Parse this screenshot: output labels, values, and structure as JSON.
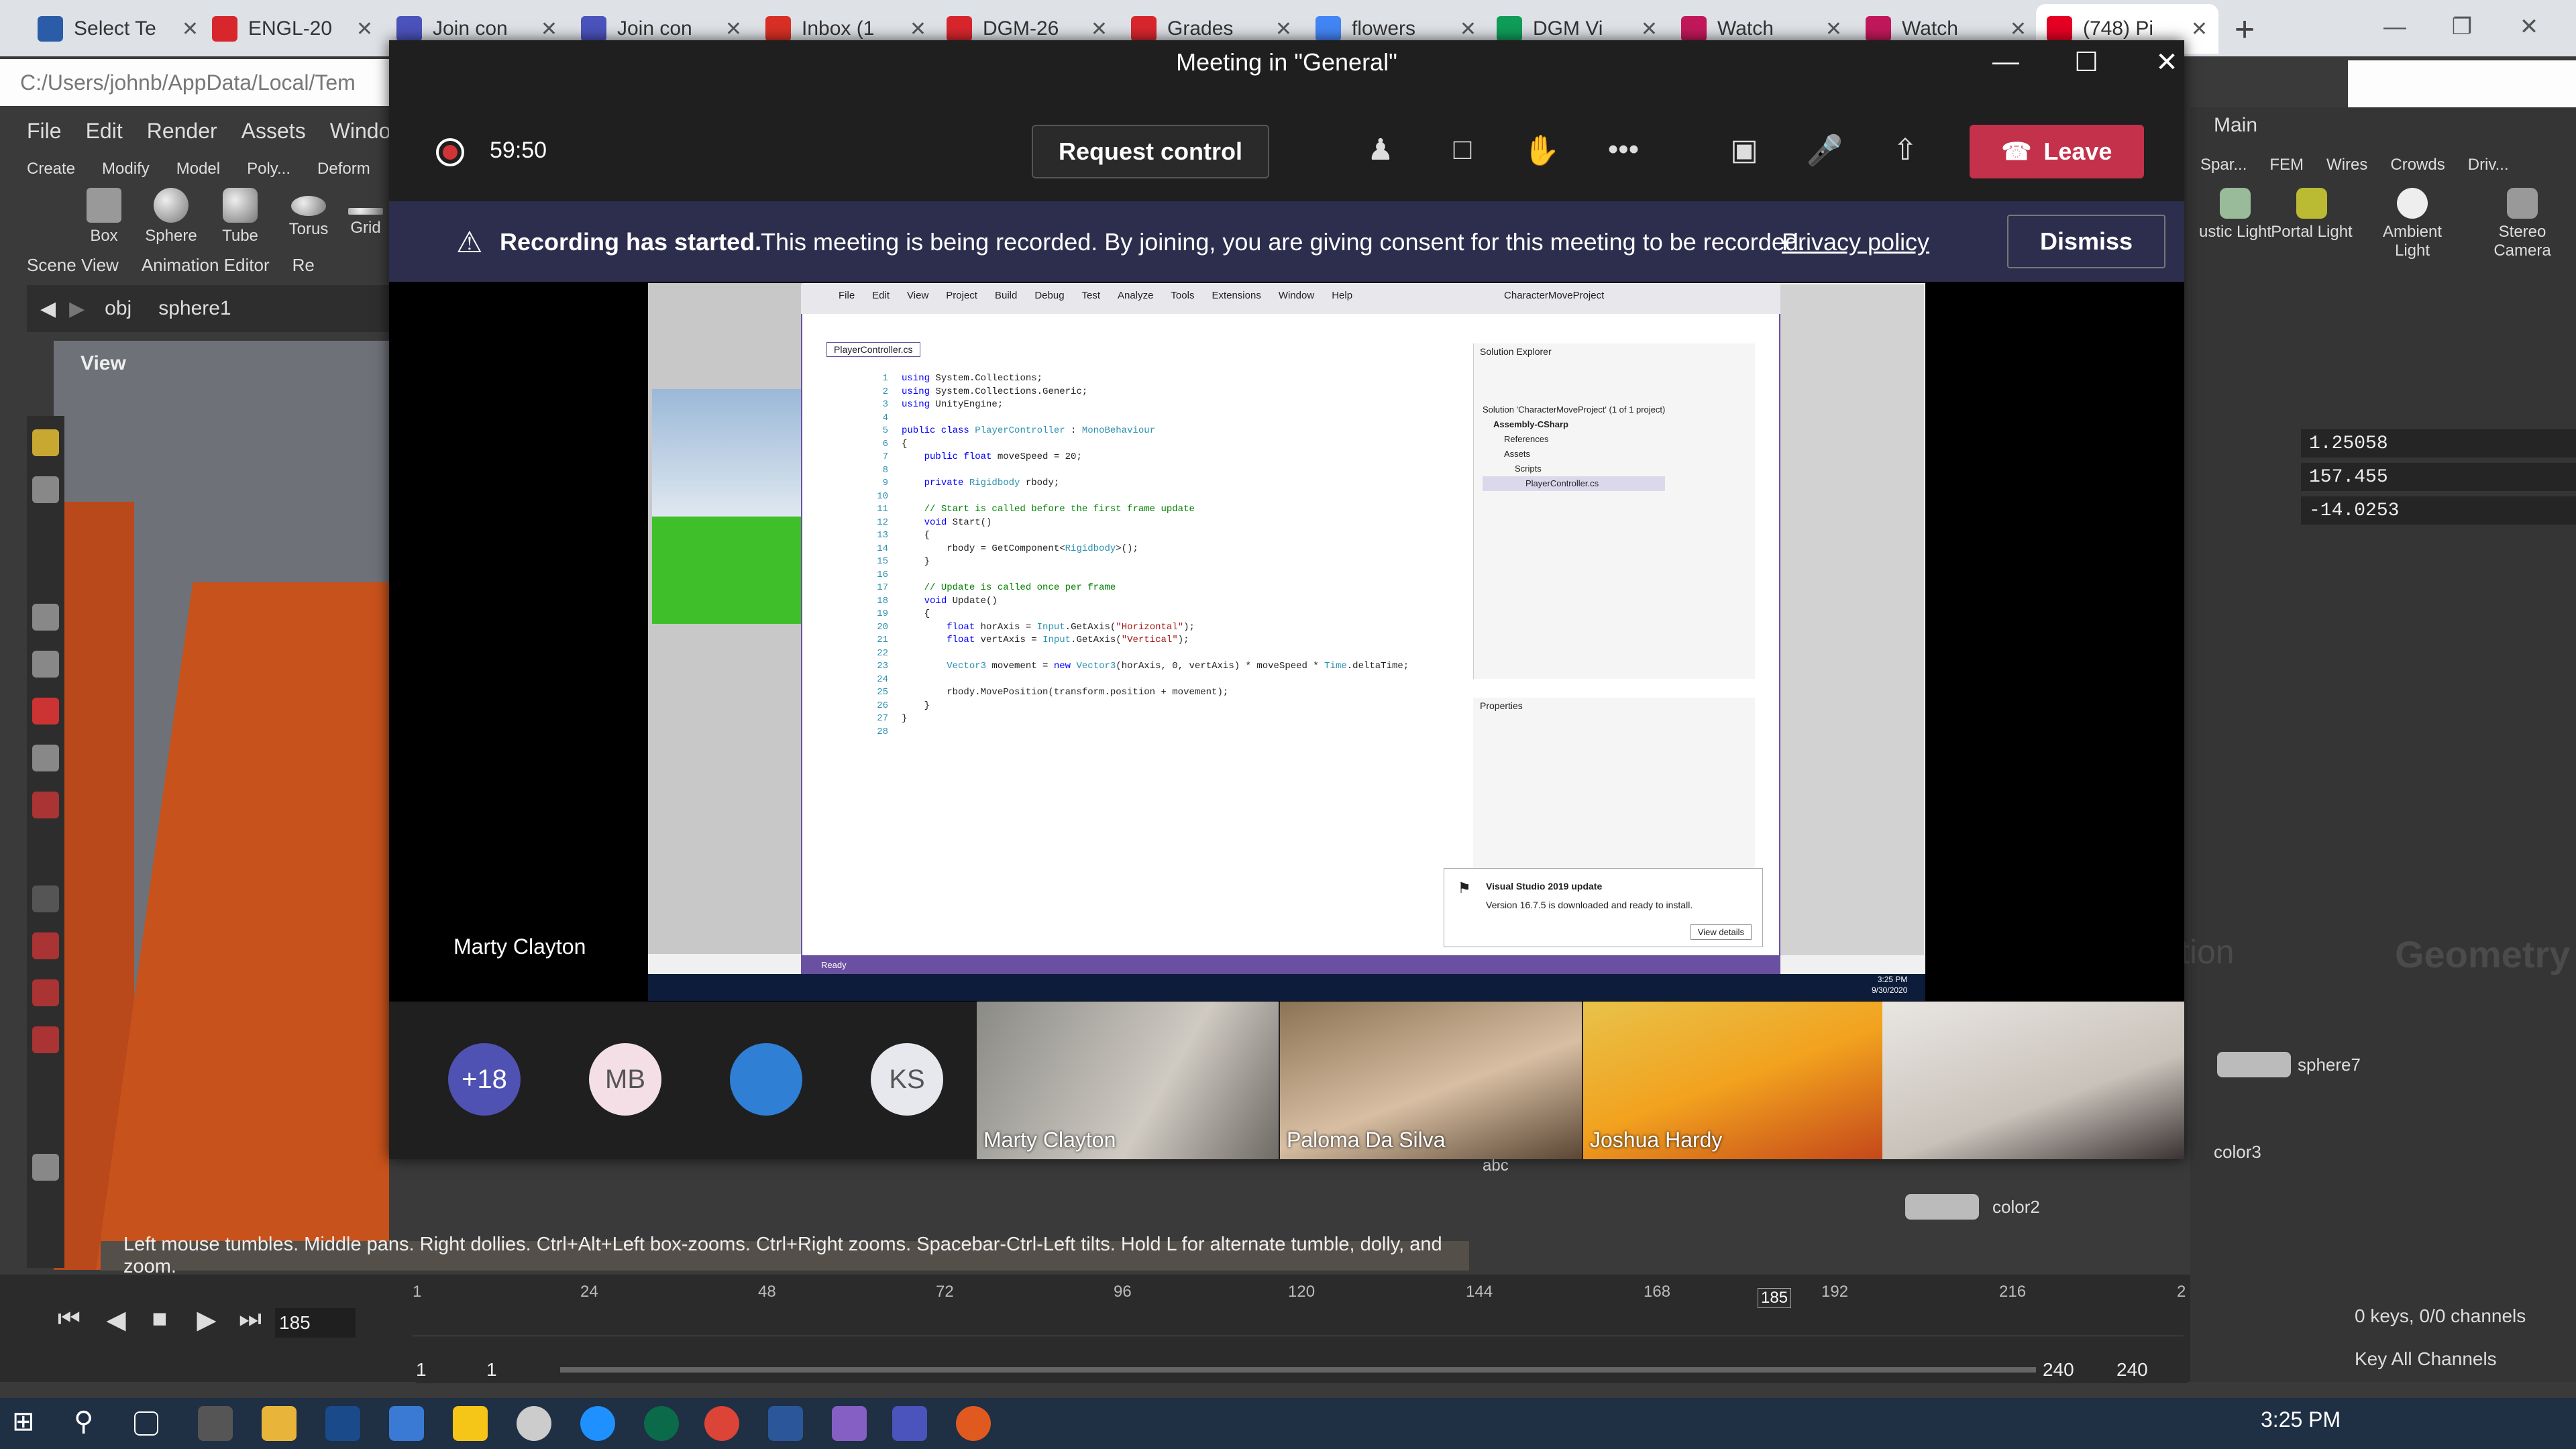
{
  "browser": {
    "tabs": [
      {
        "label": "Select Te",
        "color": "#2a5ca8"
      },
      {
        "label": "ENGL-20",
        "color": "#d8262d"
      },
      {
        "label": "Join con",
        "color": "#4b53bc"
      },
      {
        "label": "Join con",
        "color": "#4b53bc"
      },
      {
        "label": "Inbox (1",
        "color": "#d93025"
      },
      {
        "label": "DGM-26",
        "color": "#d8262d"
      },
      {
        "label": "Grades",
        "color": "#d8262d"
      },
      {
        "label": "flowers",
        "color": "#4285f4"
      },
      {
        "label": "DGM Vi",
        "color": "#0f9d58"
      },
      {
        "label": "Watch",
        "color": "#c2185b"
      },
      {
        "label": "Watch",
        "color": "#c2185b"
      },
      {
        "label": "(748) Pi",
        "color": "#e60023"
      }
    ],
    "new_tab_glyph": "+"
  },
  "houdini": {
    "path": "C:/Users/johnb/AppData/Local/Tem",
    "menu": [
      "File",
      "Edit",
      "Render",
      "Assets",
      "Windows"
    ],
    "shelf_tabs": [
      "Create",
      "Modify",
      "Model",
      "Poly...",
      "Deform"
    ],
    "shelf_items": [
      "Box",
      "Sphere",
      "Tube",
      "Torus",
      "Grid"
    ],
    "scene_tabs": [
      "Scene View",
      "Animation Editor",
      "Re"
    ],
    "obj_path": [
      "obj",
      "sphere1"
    ],
    "view_label": "View",
    "hint": "Left mouse tumbles. Middle pans. Right dollies. Ctrl+Alt+Left box-zooms. Ctrl+Right zooms. Spacebar-Ctrl-Left tilts. Hold L for alternate tumble, dolly, and zoom.",
    "right_main": "Main",
    "right_tabs": [
      "Spar...",
      "FEM",
      "Wires",
      "Crowds",
      "Driv..."
    ],
    "right_shelf": [
      "ustic Light",
      "Portal Light",
      "Ambient Light",
      "Stereo Camera"
    ],
    "values": [
      "1.25058",
      "157.455",
      "-14.0253"
    ],
    "network_label": "Geometry",
    "action_label": "tion",
    "nodes": [
      "sphere7",
      "color3",
      "color2"
    ],
    "abc": "abc",
    "timeline": {
      "ticks": [
        "1",
        "24",
        "48",
        "72",
        "96",
        "120",
        "144",
        "168",
        "185",
        "192",
        "216",
        "2"
      ],
      "frame": "185",
      "range_start": "1",
      "range_start2": "1",
      "range_end": "240",
      "range_end2": "240",
      "keys": "0 keys, 0/0 channels",
      "key_all": "Key All Channels"
    }
  },
  "teams": {
    "title": "Meeting in \"General\"",
    "timer": "59:50",
    "request_control": "Request control",
    "leave": "Leave",
    "banner_bold": "Recording has started.",
    "banner_text": "This meeting is being recorded. By joining, you are giving consent for this meeting to be recorded.",
    "banner_link": "Privacy policy",
    "dismiss": "Dismiss",
    "presenter": "Marty Clayton",
    "avatars": [
      {
        "label": "+18",
        "bg": "#4f52b2",
        "fg": "#ffffff"
      },
      {
        "label": "MB",
        "bg": "#f3dfe5",
        "fg": "#555555"
      },
      {
        "label": "",
        "bg": "#2f7fd5",
        "fg": "#ffffff"
      },
      {
        "label": "KS",
        "bg": "#e6e8ee",
        "fg": "#555555"
      }
    ],
    "video_tiles": [
      "Marty Clayton",
      "Paloma Da Silva",
      "Joshua Hardy",
      ""
    ],
    "shared": {
      "vs_menu": [
        "File",
        "Edit",
        "View",
        "Project",
        "Build",
        "Debug",
        "Test",
        "Analyze",
        "Tools",
        "Extensions",
        "Window",
        "Help"
      ],
      "vs_title": "CharacterMoveProject",
      "file_tab": "PlayerController.cs",
      "solution_explorer": "Solution Explorer",
      "solution_items": [
        "Solution 'CharacterMoveProject' (1 of 1 project)",
        "Assembly-CSharp",
        "References",
        "Assets",
        "Scripts",
        "PlayerController.cs"
      ],
      "properties": "Properties",
      "notif_title": "Visual Studio 2019 update",
      "notif_text": "Version 16.7.5 is downloaded and ready to install.",
      "notif_btn": "View details",
      "status": "Ready",
      "clock": "3:25 PM",
      "date": "9/30/2020"
    }
  },
  "taskbar": {
    "time": "3:25 PM"
  }
}
